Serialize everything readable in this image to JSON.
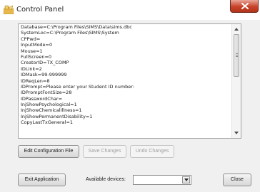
{
  "window": {
    "title": "Control Panel",
    "close_label": "x"
  },
  "config_text": {
    "lines": [
      "Database=C:\\Program Files\\SIMS\\Data\\sims.dbc",
      "SystemLoc=C:\\Program Files\\SIMS\\System",
      "CPPwd=",
      "InputMode=0",
      "Mouse=1",
      "FullScreen=0",
      "CreatorID=TX_COMP",
      "IDLink=2",
      "IDMask=99-999999",
      "IDReqLen=8",
      "IDPrompt=Please enter your Student ID number:",
      "IDPromptFontSize=28",
      "IDPasswordChar=",
      "InjShowPsychological=1",
      "InjShowChemicalIllness=1",
      "InjShowPermanentDisability=1",
      "CopyLastTxGeneral=1"
    ]
  },
  "buttons": {
    "edit_config": "Edit Configuration File",
    "save_changes": "Save Changes",
    "undo_changes": "Undo Changes",
    "exit_app": "Exit Application",
    "close": "Close"
  },
  "devices": {
    "label": "Available devices:",
    "selected": ""
  }
}
